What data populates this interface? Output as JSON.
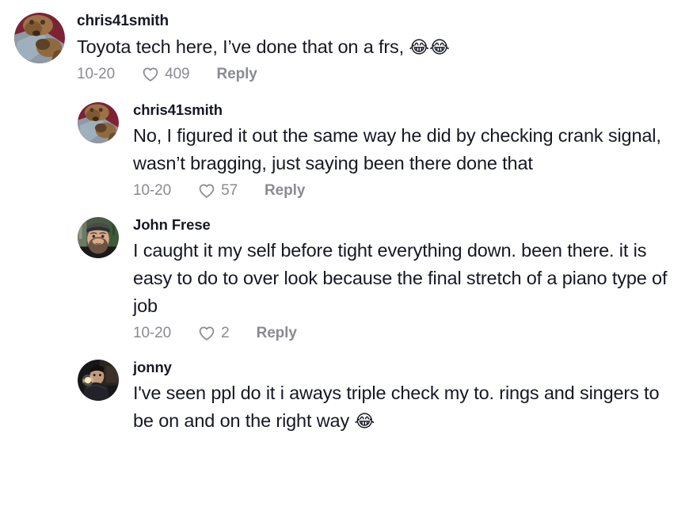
{
  "comments": [
    {
      "username": "chris41smith",
      "level": 0,
      "avatar": "dog-photo-avatar",
      "text": "Toyota tech here, I’ve done that on a frs, ",
      "emoji": "😂😂",
      "date": "10-20",
      "likes": "409",
      "reply_label": "Reply",
      "like_icon": "heart-icon"
    },
    {
      "username": "chris41smith",
      "level": 1,
      "avatar": "dog-photo-avatar",
      "text": "No, I figured it out the same way he did by checking crank signal, wasn’t bragging, just saying been there done that",
      "emoji": "",
      "date": "10-20",
      "likes": "57",
      "reply_label": "Reply",
      "like_icon": "heart-icon"
    },
    {
      "username": "John Frese",
      "level": 1,
      "avatar": "man-cap-photo-avatar",
      "text": "I caught it my self before tight everything down. been there. it is easy to do to over look because the final stretch of a piano type of job",
      "emoji": "",
      "date": "10-20",
      "likes": "2",
      "reply_label": "Reply",
      "like_icon": "heart-icon"
    },
    {
      "username": "jonny",
      "level": 1,
      "avatar": "man-dark-photo-avatar",
      "text": "I've seen ppl do it i aways triple check my to. rings and singers to be on and on the right way ",
      "emoji": "😂",
      "date": "",
      "likes": "",
      "reply_label": "",
      "like_icon": ""
    }
  ],
  "colors": {
    "text": "#161823",
    "meta": "#8a8b91",
    "background": "#ffffff"
  }
}
